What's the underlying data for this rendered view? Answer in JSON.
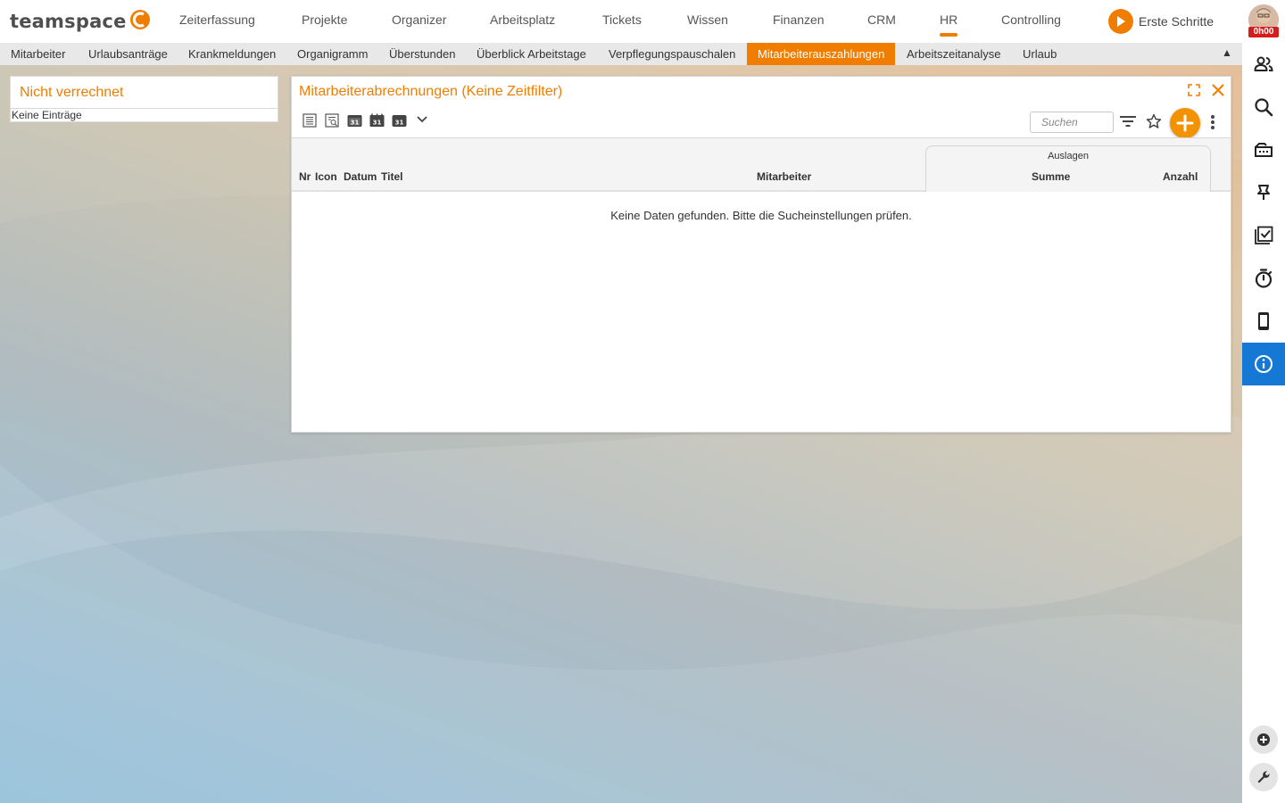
{
  "app": {
    "logo_text": "teamspace",
    "timer": "0h00"
  },
  "mainnav": {
    "items": [
      {
        "label": "Zeiterfassung"
      },
      {
        "label": "Projekte"
      },
      {
        "label": "Organizer"
      },
      {
        "label": "Arbeitsplatz"
      },
      {
        "label": "Tickets"
      },
      {
        "label": "Wissen"
      },
      {
        "label": "Finanzen"
      },
      {
        "label": "CRM"
      },
      {
        "label": "HR",
        "active": true
      },
      {
        "label": "Controlling"
      }
    ],
    "erste_schritte": "Erste Schritte"
  },
  "subnav": {
    "items": [
      {
        "label": "Mitarbeiter"
      },
      {
        "label": "Urlaubsanträge"
      },
      {
        "label": "Krankmeldungen"
      },
      {
        "label": "Organigramm"
      },
      {
        "label": "Überstunden"
      },
      {
        "label": "Überblick Arbeitstage"
      },
      {
        "label": "Verpflegungspauschalen"
      },
      {
        "label": "Mitarbeiterauszahlungen",
        "active": true
      },
      {
        "label": "Arbeitszeitanalyse"
      },
      {
        "label": "Urlaub"
      }
    ],
    "toggle": "▲"
  },
  "leftpanel": {
    "title": "Nicht verrechnet",
    "empty": "Keine Einträge"
  },
  "mainpanel": {
    "title": "Mitarbeiterabrechnungen (Keine Zeitfilter)",
    "search_placeholder": "Suchen",
    "columns": {
      "nr": "Nr",
      "icon": "Icon",
      "datum": "Datum",
      "titel": "Titel",
      "mitarbeiter": "Mitarbeiter",
      "group": "Auslagen",
      "summe": "Summe",
      "anzahl": "Anzahl"
    },
    "empty_message": "Keine Daten gefunden. Bitte die Sucheinstellungen prüfen."
  },
  "icons": {
    "toolbar": [
      "list-view-icon",
      "detail-view-icon",
      "calendar-day-icon",
      "calendar-week-icon",
      "calendar-month-icon",
      "chevron-down-icon",
      "filter-icon",
      "star-icon",
      "add-icon",
      "more-vert-icon"
    ],
    "rightbar": [
      "people-icon",
      "search-icon",
      "inbox-icon",
      "pin-icon",
      "tasks-icon",
      "stopwatch-icon",
      "mobile-icon",
      "info-icon",
      "add-circle-icon",
      "wrench-icon"
    ]
  },
  "colors": {
    "accent": "#f07d00",
    "active_blue": "#1478d4",
    "timer_badge": "#d61d1d"
  }
}
